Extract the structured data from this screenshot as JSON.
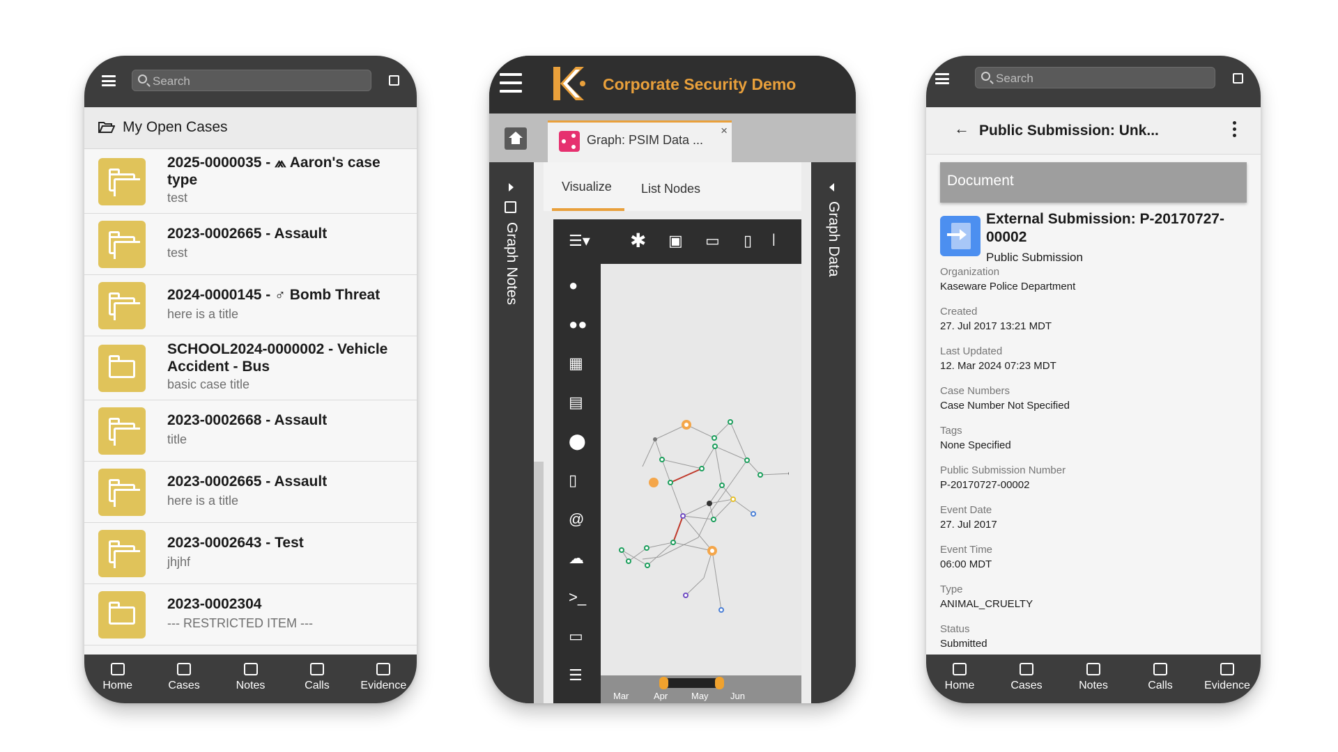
{
  "left_phone": {
    "search_placeholder": "Search",
    "section_title": "My Open Cases",
    "cases": [
      {
        "title": "2025-0000035 - ⩕ Aaron's case type",
        "subtitle": "test"
      },
      {
        "title": "2023-0002665 - Assault",
        "subtitle": "test"
      },
      {
        "title": "2024-0000145 - ♂ Bomb Threat",
        "subtitle": "here is a title"
      },
      {
        "title": "SCHOOL2024-0000002 - Vehicle Accident - Bus",
        "subtitle": "basic case title"
      },
      {
        "title": "2023-0002668 - Assault",
        "subtitle": "title"
      },
      {
        "title": "2023-0002665 - Assault",
        "subtitle": "here is a title"
      },
      {
        "title": "2023-0002643 - Test",
        "subtitle": "jhjhf"
      },
      {
        "title": "2023-0002304",
        "subtitle": "--- RESTRICTED ITEM ---"
      }
    ],
    "nav": [
      "Home",
      "Cases",
      "Notes",
      "Calls",
      "Evidence"
    ]
  },
  "middle_phone": {
    "app_title": "Corporate Security Demo",
    "tab_label": "Graph: PSIM Data ...",
    "tab_close": "×",
    "left_panel_label": "Graph Notes",
    "right_panel_label": "Graph Data",
    "inner_tabs": [
      "Visualize",
      "List Nodes"
    ],
    "timeline_months": [
      "Mar",
      "Apr",
      "May",
      "Jun"
    ],
    "accent_color": "#e9a03b"
  },
  "right_phone": {
    "search_placeholder": "Search",
    "record_title": "Public Submission: Unk...",
    "section_label": "Document",
    "document_title": "External Submission: P-20170727-00002",
    "document_type": "Public Submission",
    "fields": [
      {
        "label": "Organization",
        "value": "Kaseware Police Department"
      },
      {
        "label": "Created",
        "value": "27. Jul 2017 13:21 MDT"
      },
      {
        "label": "Last Updated",
        "value": "12. Mar 2024 07:23 MDT"
      },
      {
        "label": "Case Numbers",
        "value": "Case Number Not Specified"
      },
      {
        "label": "Tags",
        "value": "None Specified"
      },
      {
        "label": "Public Submission Number",
        "value": "P-20170727-00002"
      },
      {
        "label": "Event Date",
        "value": "27. Jul 2017"
      },
      {
        "label": "Event Time",
        "value": "06:00 MDT"
      },
      {
        "label": "Type",
        "value": "ANIMAL_CRUELTY"
      },
      {
        "label": "Status",
        "value": "Submitted"
      }
    ],
    "nav": [
      "Home",
      "Cases",
      "Notes",
      "Calls",
      "Evidence"
    ]
  }
}
